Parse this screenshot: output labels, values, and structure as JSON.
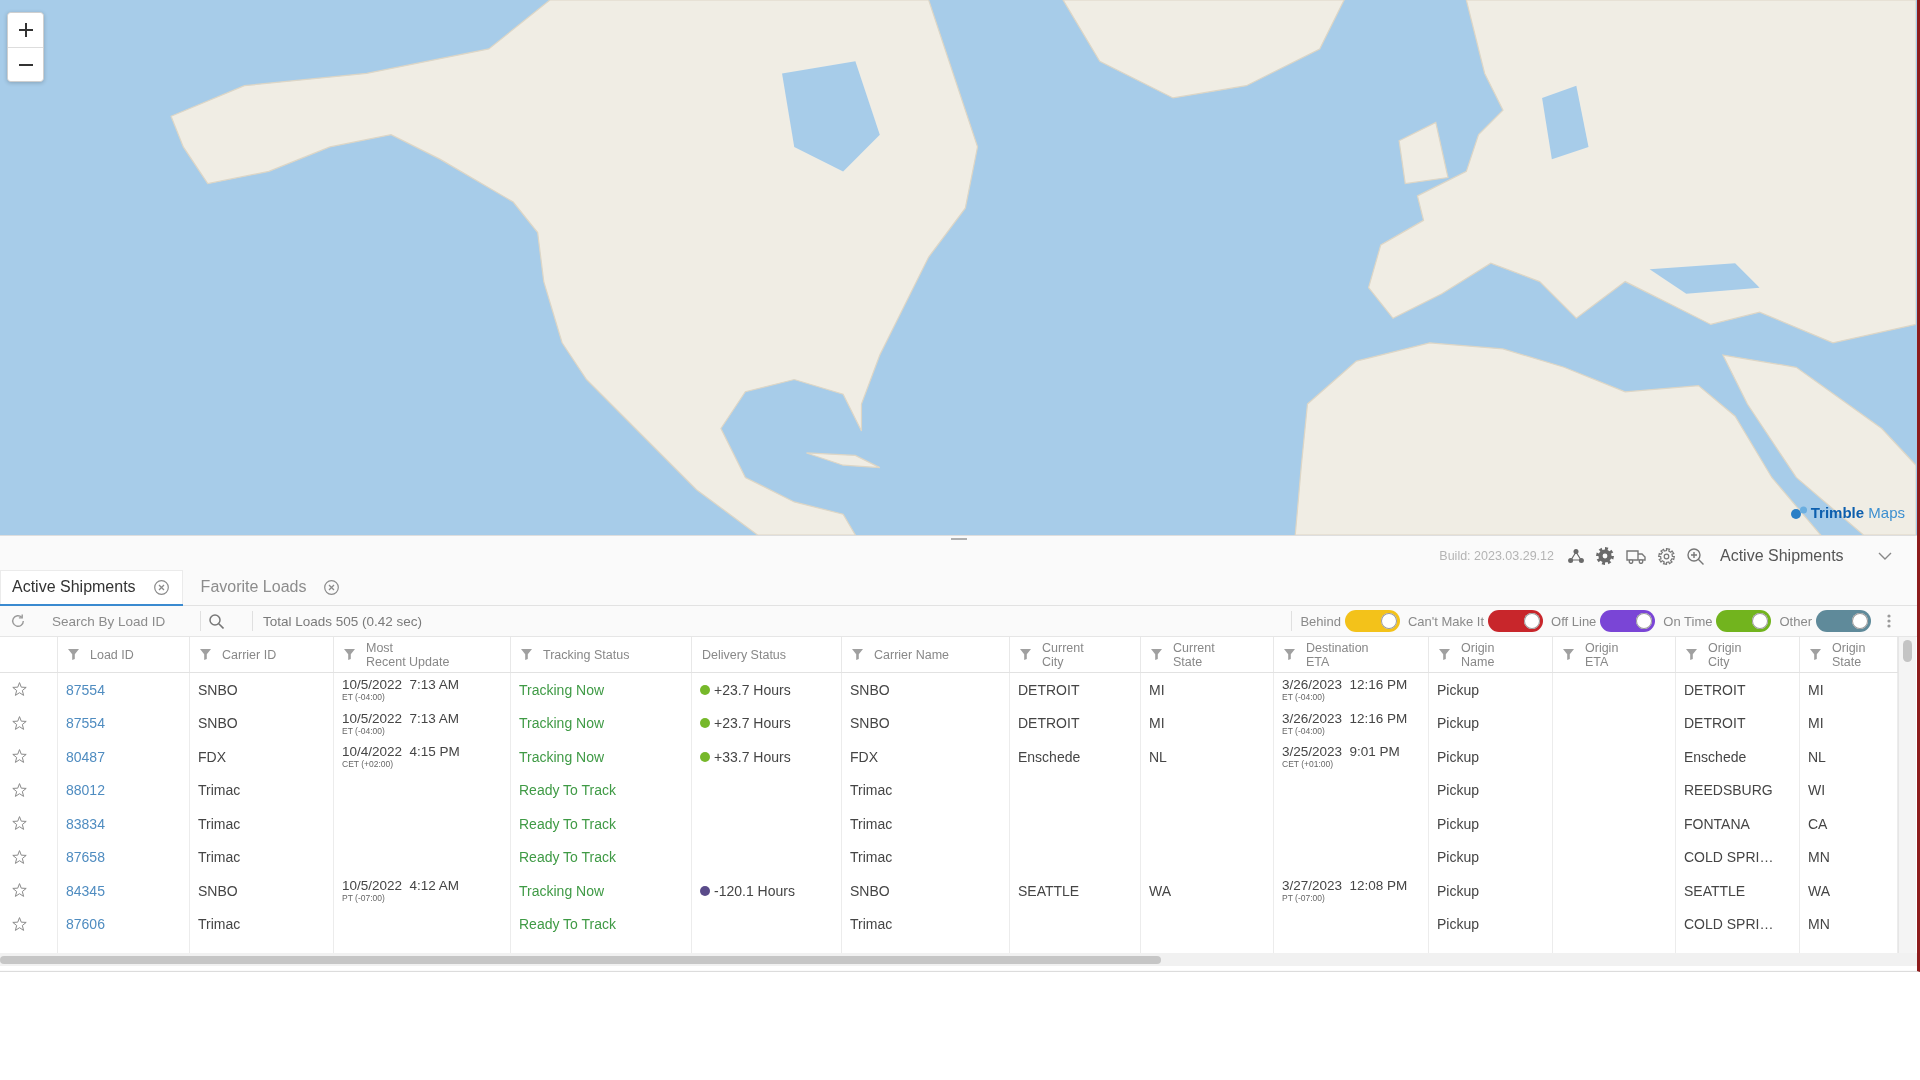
{
  "map": {
    "attribution": "**Trimble** Maps"
  },
  "header": {
    "build": "Build: 2023.03.29.12",
    "view_select": "Active Shipments"
  },
  "tabs": [
    {
      "label": "Active Shipments",
      "selected": true
    },
    {
      "label": "Favorite Loads",
      "selected": false
    }
  ],
  "toolbar": {
    "search": {
      "placeholder": "Search By Load ID"
    },
    "total": "Total Loads 505 (0.42 sec)",
    "filters": [
      {
        "label": "Behind",
        "on": true,
        "color": "#f3c21a"
      },
      {
        "label": "Can't Make It",
        "on": true,
        "color": "#c8262b"
      },
      {
        "label": "Off Line",
        "on": true,
        "color": "#7a45d6"
      },
      {
        "label": "On Time",
        "on": true,
        "color": "#72b41e"
      },
      {
        "label": "Other",
        "on": true,
        "color": "#5f8a9a"
      }
    ]
  },
  "table": {
    "columns": [
      {
        "label": "Load ID",
        "filter": true
      },
      {
        "label": "Carrier ID",
        "filter": true
      },
      {
        "label": "Most\nRecent Update",
        "filter": true
      },
      {
        "label": "Tracking Status",
        "filter": true
      },
      {
        "label": "Delivery Status",
        "filter": false
      },
      {
        "label": "Carrier Name",
        "filter": true
      },
      {
        "label": "Current\nCity",
        "filter": true
      },
      {
        "label": "Current\nState",
        "filter": true
      },
      {
        "label": "Destination\nETA",
        "filter": true
      },
      {
        "label": "Origin\nName",
        "filter": true
      },
      {
        "label": "Origin\nETA",
        "filter": true
      },
      {
        "label": "Origin\nCity",
        "filter": true
      },
      {
        "label": "Origin\nState",
        "filter": true
      }
    ],
    "rows": [
      {
        "starred": false,
        "load_id": "87554",
        "carrier_id": "SNBO",
        "most_recent_update": {
          "time": "10/5/2022  7:13 AM",
          "zone": "ET (-04:00)"
        },
        "tracking_status": "Tracking Now",
        "delivery_status": {
          "text": "+23.7 Hours",
          "color": "#76b82a"
        },
        "carrier_name": "SNBO",
        "current_city": "DETROIT",
        "current_state": "MI",
        "destination_eta": {
          "time": "3/26/2023  12:16 PM",
          "zone": "ET (-04:00)"
        },
        "origin_name": "Pickup",
        "origin_city": "DETROIT",
        "origin_state": "MI"
      },
      {
        "starred": false,
        "load_id": "87554",
        "carrier_id": "SNBO",
        "most_recent_update": {
          "time": "10/5/2022  7:13 AM",
          "zone": "ET (-04:00)"
        },
        "tracking_status": "Tracking Now",
        "delivery_status": {
          "text": "+23.7 Hours",
          "color": "#76b82a"
        },
        "carrier_name": "SNBO",
        "current_city": "DETROIT",
        "current_state": "MI",
        "destination_eta": {
          "time": "3/26/2023  12:16 PM",
          "zone": "ET (-04:00)"
        },
        "origin_name": "Pickup",
        "origin_city": "DETROIT",
        "origin_state": "MI"
      },
      {
        "starred": false,
        "load_id": "80487",
        "carrier_id": "FDX",
        "most_recent_update": {
          "time": "10/4/2022  4:15 PM",
          "zone": "CET (+02:00)"
        },
        "tracking_status": "Tracking Now",
        "delivery_status": {
          "text": "+33.7 Hours",
          "color": "#76b82a"
        },
        "carrier_name": "FDX",
        "current_city": "Enschede",
        "current_state": "NL",
        "destination_eta": {
          "time": "3/25/2023  9:01 PM",
          "zone": "CET (+01:00)"
        },
        "origin_name": "Pickup",
        "origin_city": "Enschede",
        "origin_state": "NL"
      },
      {
        "starred": false,
        "load_id": "88012",
        "carrier_id": "Trimac",
        "tracking_status": "Ready To Track",
        "carrier_name": "Trimac",
        "origin_name": "Pickup",
        "origin_city": "REEDSBURG",
        "origin_state": "WI"
      },
      {
        "starred": false,
        "load_id": "83834",
        "carrier_id": "Trimac",
        "tracking_status": "Ready To Track",
        "carrier_name": "Trimac",
        "origin_name": "Pickup",
        "origin_city": "FONTANA",
        "origin_state": "CA"
      },
      {
        "starred": false,
        "load_id": "87658",
        "carrier_id": "Trimac",
        "tracking_status": "Ready To Track",
        "carrier_name": "Trimac",
        "origin_name": "Pickup",
        "origin_city": "COLD SPRI…",
        "origin_state": "MN"
      },
      {
        "starred": false,
        "load_id": "84345",
        "carrier_id": "SNBO",
        "most_recent_update": {
          "time": "10/5/2022  4:12 AM",
          "zone": "PT (-07:00)"
        },
        "tracking_status": "Tracking Now",
        "delivery_status": {
          "text": "-120.1 Hours",
          "color": "#5a4b8a"
        },
        "carrier_name": "SNBO",
        "current_city": "SEATTLE",
        "current_state": "WA",
        "destination_eta": {
          "time": "3/27/2023  12:08 PM",
          "zone": "PT (-07:00)"
        },
        "origin_name": "Pickup",
        "origin_city": "SEATTLE",
        "origin_state": "WA"
      },
      {
        "starred": false,
        "load_id": "87606",
        "carrier_id": "Trimac",
        "tracking_status": "Ready To Track",
        "carrier_name": "Trimac",
        "origin_name": "Pickup",
        "origin_city": "COLD SPRI…",
        "origin_state": "MN"
      }
    ]
  }
}
